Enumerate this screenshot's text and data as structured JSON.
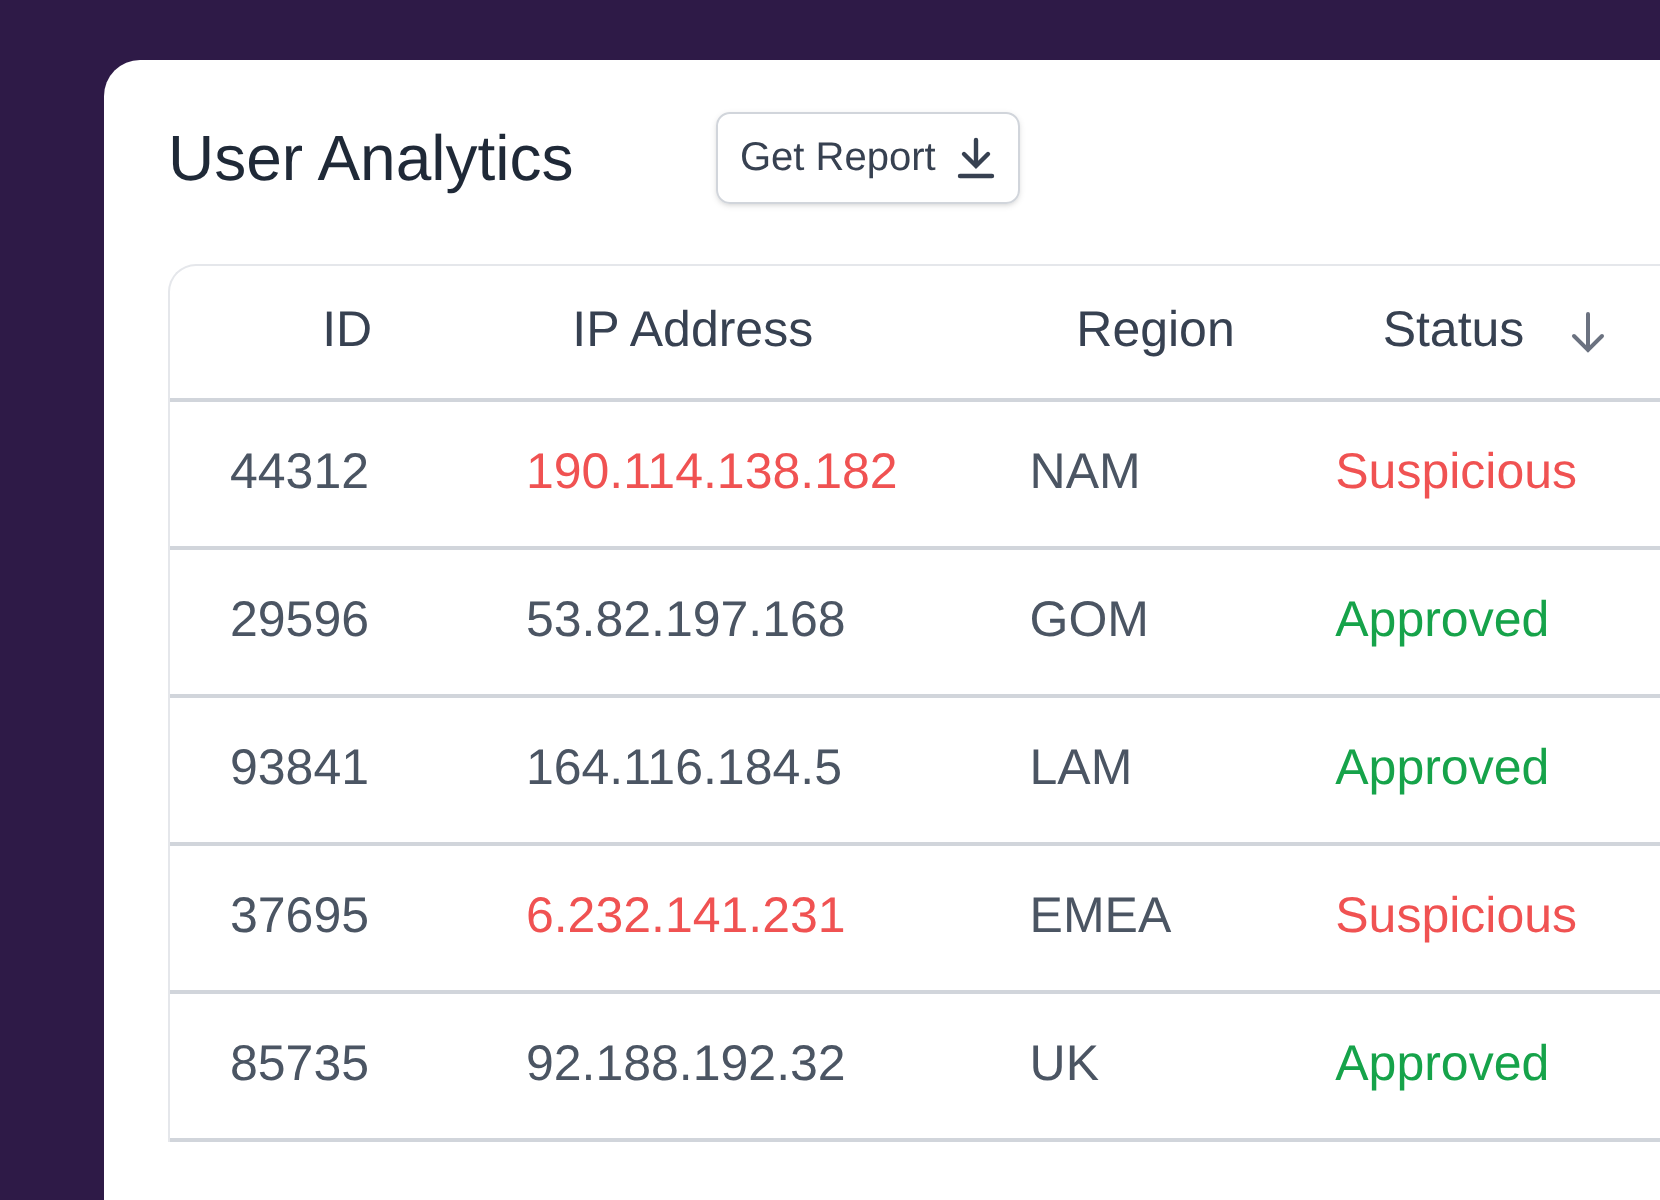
{
  "card": {
    "title": "User Analytics",
    "report_button": {
      "label": "Get Report"
    }
  },
  "table": {
    "columns": [
      {
        "label": "ID",
        "sorted": false
      },
      {
        "label": "IP Address",
        "sorted": false
      },
      {
        "label": "Region",
        "sorted": false
      },
      {
        "label": "Status",
        "sorted": true
      }
    ],
    "rows": [
      {
        "id": "44312",
        "ip": "190.114.138.182",
        "region": "NAM",
        "status": "Suspicious",
        "suspicious": true
      },
      {
        "id": "29596",
        "ip": "53.82.197.168",
        "region": "GOM",
        "status": "Approved",
        "suspicious": false
      },
      {
        "id": "93841",
        "ip": "164.116.184.5",
        "region": "LAM",
        "status": "Approved",
        "suspicious": false
      },
      {
        "id": "37695",
        "ip": "6.232.141.231",
        "region": "EMEA",
        "status": "Suspicious",
        "suspicious": true
      },
      {
        "id": "85735",
        "ip": "92.188.192.32",
        "region": "UK",
        "status": "Approved",
        "suspicious": false
      }
    ]
  }
}
